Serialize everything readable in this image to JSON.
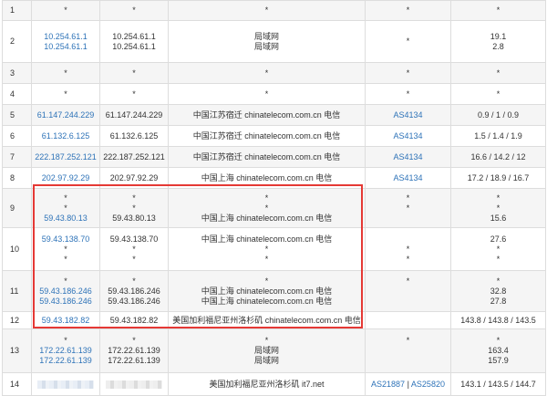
{
  "hops": [
    {
      "hop": "1",
      "ips": [
        "*"
      ],
      "hosts": [
        "*"
      ],
      "locs": [
        "*"
      ],
      "asns": [],
      "times": [
        "*"
      ],
      "asn_star": true
    },
    {
      "hop": "2",
      "ips": [
        "10.254.61.1",
        "10.254.61.1"
      ],
      "hosts": [
        "10.254.61.1",
        "10.254.61.1"
      ],
      "locs": [
        "局域网",
        "局域网"
      ],
      "asn_star": true,
      "times": [
        "19.1",
        "2.8"
      ]
    },
    {
      "hop": "3",
      "ips": [
        "*"
      ],
      "hosts": [
        "*"
      ],
      "locs": [
        "*"
      ],
      "asn_star": true,
      "times": [
        "*"
      ]
    },
    {
      "hop": "4",
      "ips": [
        "*"
      ],
      "hosts": [
        "*"
      ],
      "locs": [
        "*"
      ],
      "asn_star": true,
      "times": [
        "*"
      ]
    },
    {
      "hop": "5",
      "ips": [
        "61.147.244.229"
      ],
      "hosts": [
        "61.147.244.229"
      ],
      "locs": [
        "中国江苏宿迁 chinatelecom.com.cn 电信"
      ],
      "asns": [
        "AS4134"
      ],
      "times": [
        "0.9 / 1 / 0.9"
      ]
    },
    {
      "hop": "6",
      "ips": [
        "61.132.6.125"
      ],
      "hosts": [
        "61.132.6.125"
      ],
      "locs": [
        "中国江苏宿迁 chinatelecom.com.cn 电信"
      ],
      "asns": [
        "AS4134"
      ],
      "times": [
        "1.5 / 1.4 / 1.9"
      ]
    },
    {
      "hop": "7",
      "ips": [
        "222.187.252.121"
      ],
      "hosts": [
        "222.187.252.121"
      ],
      "locs": [
        "中国江苏宿迁 chinatelecom.com.cn 电信"
      ],
      "asns": [
        "AS4134"
      ],
      "times": [
        "16.6 / 14.2 / 12"
      ]
    },
    {
      "hop": "8",
      "ips": [
        "202.97.92.29"
      ],
      "hosts": [
        "202.97.92.29"
      ],
      "locs": [
        "中国上海 chinatelecom.com.cn 电信"
      ],
      "asns": [
        "AS4134"
      ],
      "times": [
        "17.2 / 18.9 / 16.7"
      ]
    },
    {
      "hop": "9",
      "ips": [
        "*",
        "*",
        "59.43.80.13"
      ],
      "hosts": [
        "*",
        "*",
        "59.43.80.13"
      ],
      "locs": [
        "*",
        "*",
        "中国上海 chinatelecom.com.cn 电信"
      ],
      "asns_text": [
        "*",
        "*",
        ""
      ],
      "times": [
        "*",
        "*",
        "15.6"
      ]
    },
    {
      "hop": "10",
      "ips": [
        "59.43.138.70",
        "*",
        "*"
      ],
      "hosts": [
        "59.43.138.70",
        "*",
        "*"
      ],
      "locs": [
        "中国上海 chinatelecom.com.cn 电信",
        "*",
        "*"
      ],
      "asns_text": [
        "",
        "*",
        "*"
      ],
      "times": [
        "27.6",
        "*",
        "*"
      ]
    },
    {
      "hop": "11",
      "ips": [
        "*",
        "59.43.186.246",
        "59.43.186.246"
      ],
      "hosts": [
        "*",
        "59.43.186.246",
        "59.43.186.246"
      ],
      "locs": [
        "*",
        "中国上海 chinatelecom.com.cn 电信",
        "中国上海 chinatelecom.com.cn 电信"
      ],
      "asns_text": [
        "*",
        "",
        ""
      ],
      "times": [
        "*",
        "32.8",
        "27.8"
      ]
    },
    {
      "hop": "12",
      "ips": [
        "59.43.182.82"
      ],
      "hosts": [
        "59.43.182.82"
      ],
      "locs": [
        "美国加利福尼亚州洛杉矶 chinatelecom.com.cn 电信"
      ],
      "asns": [],
      "times": [
        "143.8 / 143.8 / 143.5"
      ]
    },
    {
      "hop": "13",
      "ips": [
        "*",
        "172.22.61.139",
        "172.22.61.139"
      ],
      "hosts": [
        "*",
        "172.22.61.139",
        "172.22.61.139"
      ],
      "locs": [
        "*",
        "局域网",
        "局域网"
      ],
      "asns_text": [
        "*",
        "",
        ""
      ],
      "times": [
        "*",
        "163.4",
        "157.9"
      ]
    },
    {
      "hop": "14",
      "ips": [],
      "hosts": [],
      "locs": [
        "美国加利福尼亚州洛杉矶 it7.net"
      ],
      "asns": [
        "AS21887",
        "AS25820"
      ],
      "times": [
        "143.1 / 143.5 / 144.7"
      ],
      "redacted": true
    }
  ],
  "colors": {
    "link": "#2e73b8",
    "highlight": "#e53935",
    "border": "#dddddd"
  }
}
